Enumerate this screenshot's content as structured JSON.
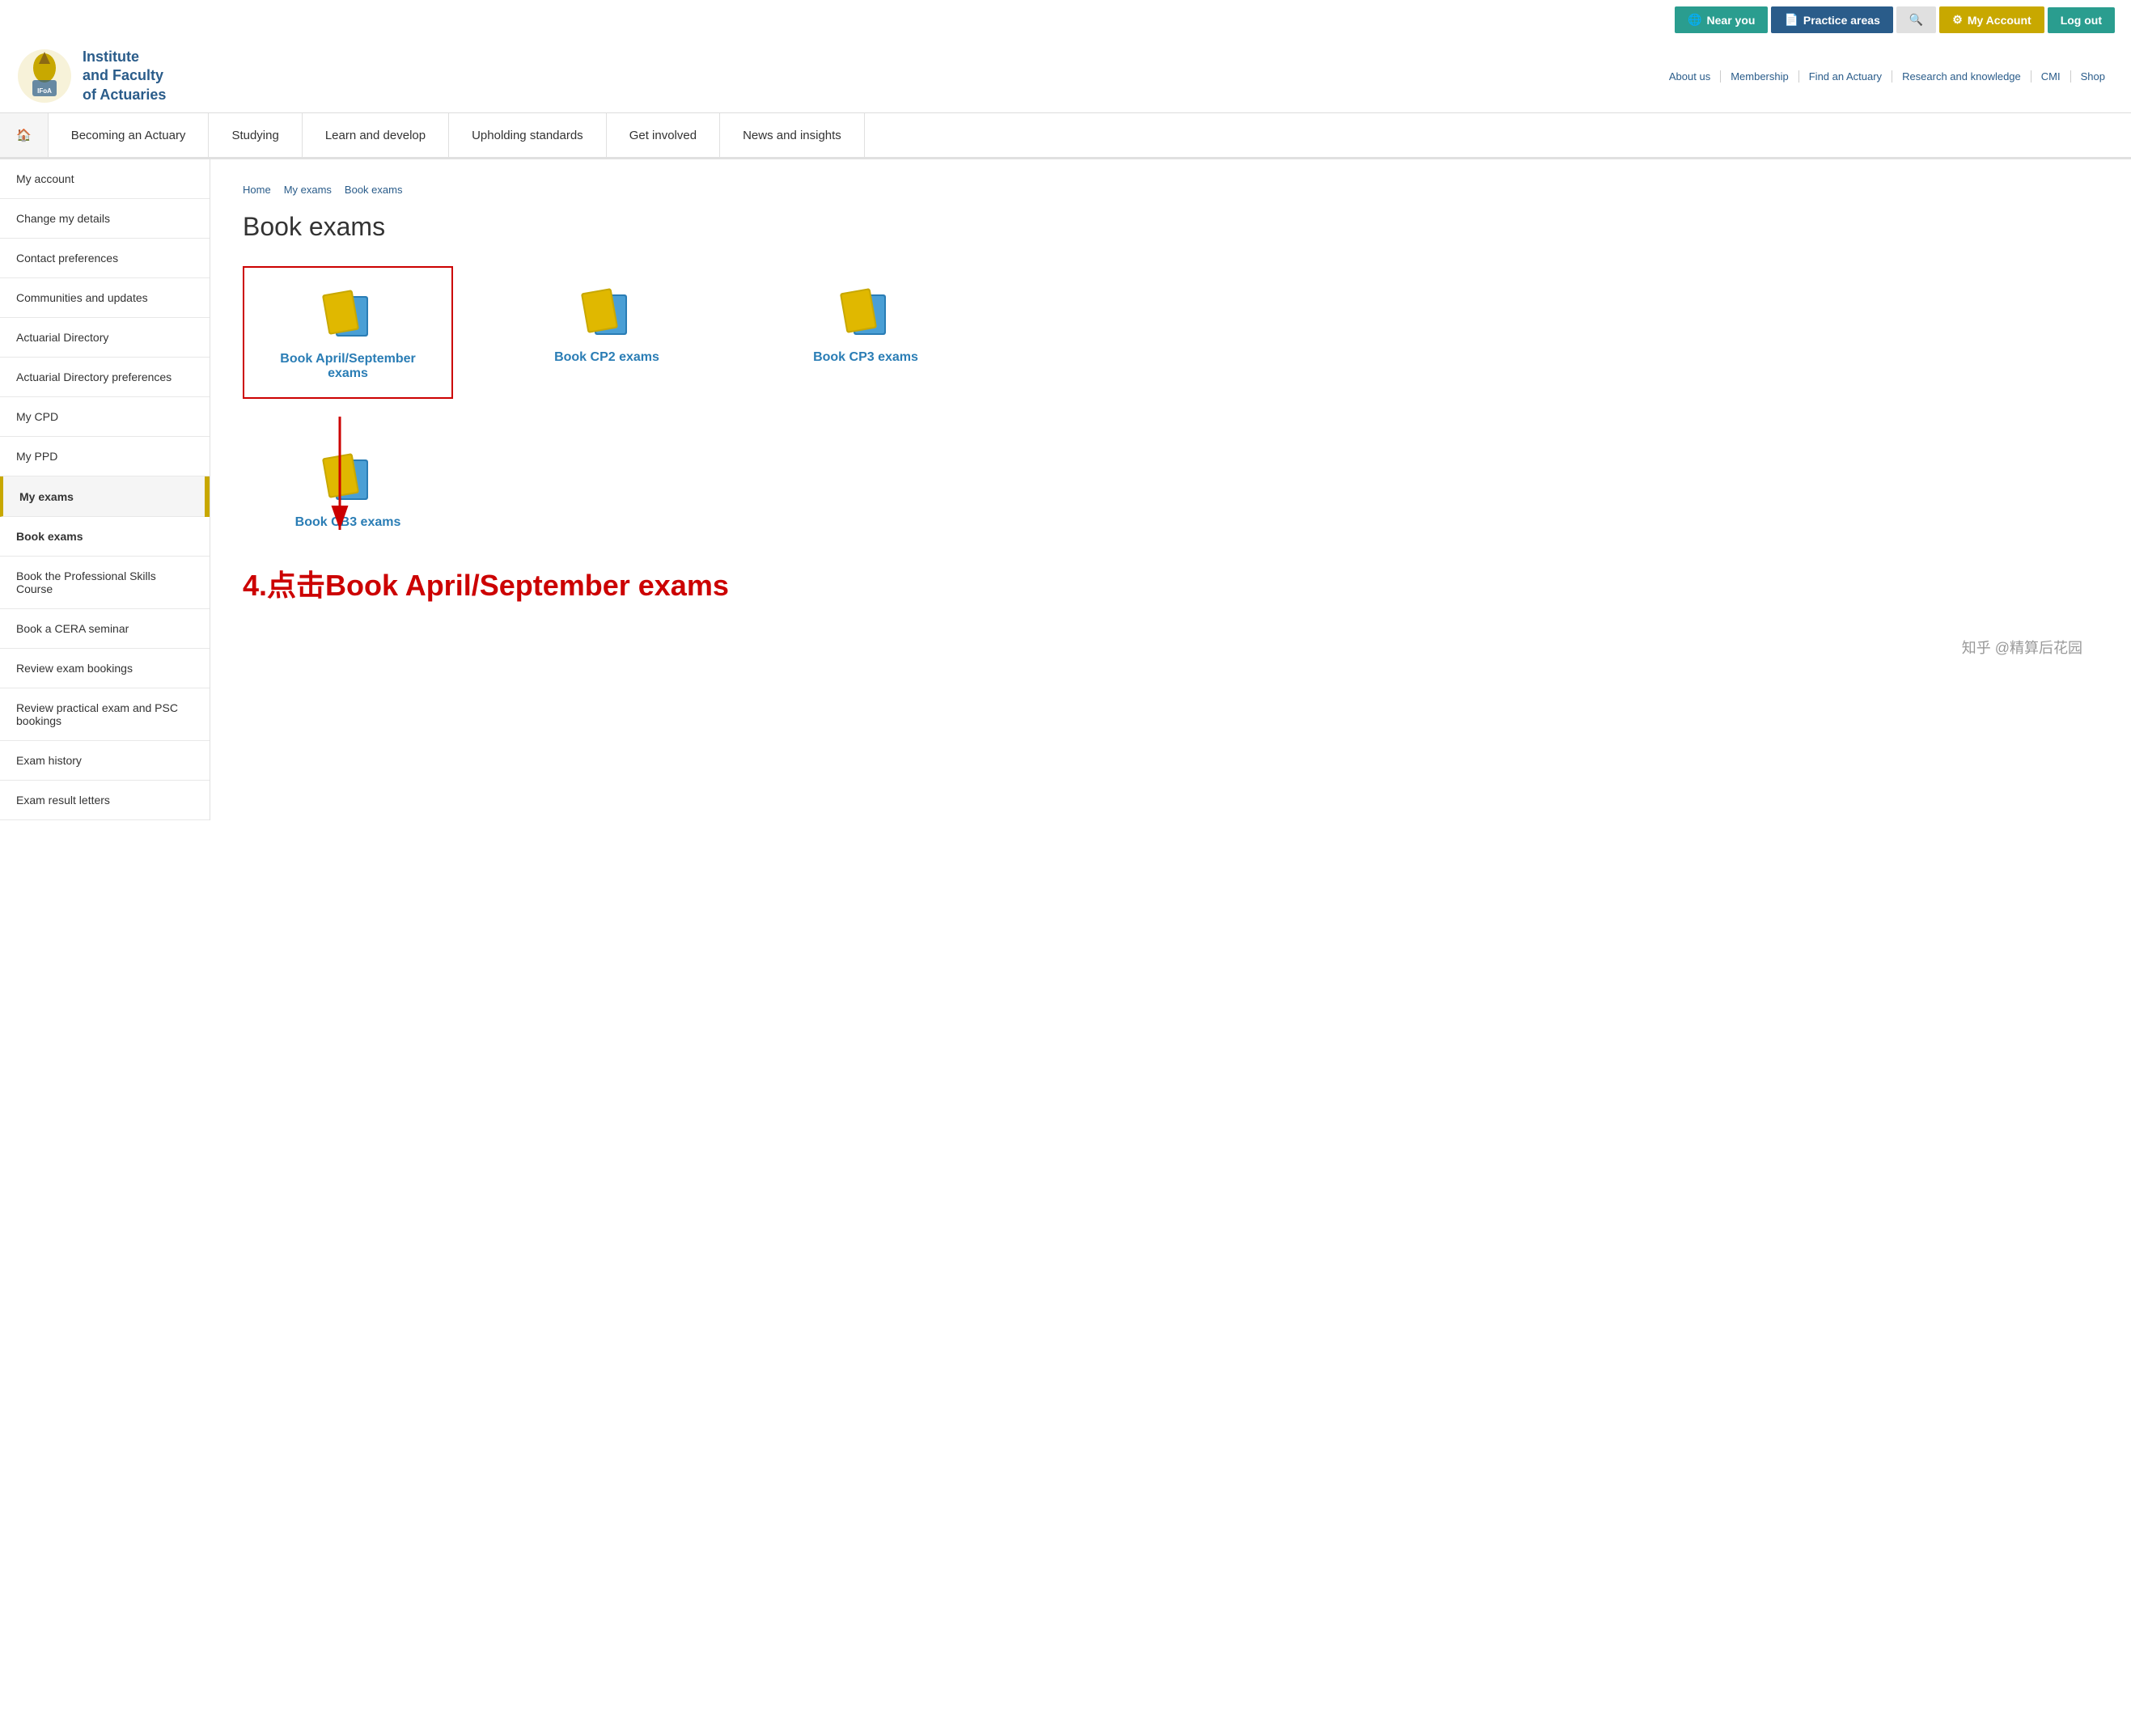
{
  "topBar": {
    "nearYou": "Near you",
    "practiceAreas": "Practice areas",
    "search": "🔍",
    "myAccount": "My Account",
    "logOut": "Log out"
  },
  "logo": {
    "line1": "Institute",
    "line2": "and Faculty",
    "line3": "of Actuaries"
  },
  "headerNav": [
    {
      "label": "About us"
    },
    {
      "label": "Membership"
    },
    {
      "label": "Find an Actuary"
    },
    {
      "label": "Research and knowledge"
    },
    {
      "label": "CMI"
    },
    {
      "label": "Shop"
    }
  ],
  "mainNav": [
    {
      "label": "🏠",
      "id": "home"
    },
    {
      "label": "Becoming an Actuary"
    },
    {
      "label": "Studying"
    },
    {
      "label": "Learn and develop"
    },
    {
      "label": "Upholding standards"
    },
    {
      "label": "Get involved"
    },
    {
      "label": "News and insights"
    }
  ],
  "sidebar": {
    "items": [
      {
        "label": "My account",
        "id": "my-account"
      },
      {
        "label": "Change my details",
        "id": "change-details"
      },
      {
        "label": "Contact preferences",
        "id": "contact-prefs"
      },
      {
        "label": "Communities and updates",
        "id": "communities"
      },
      {
        "label": "Actuarial Directory",
        "id": "actuarial-dir"
      },
      {
        "label": "Actuarial Directory preferences",
        "id": "actuarial-dir-prefs"
      },
      {
        "label": "My CPD",
        "id": "my-cpd"
      },
      {
        "label": "My PPD",
        "id": "my-ppd"
      },
      {
        "label": "My exams",
        "id": "my-exams",
        "active": true,
        "bold": true
      },
      {
        "label": "Book exams",
        "id": "book-exams",
        "bold": true
      },
      {
        "label": "Book the Professional Skills Course",
        "id": "book-psc"
      },
      {
        "label": "Book a CERA seminar",
        "id": "book-cera"
      },
      {
        "label": "Review exam bookings",
        "id": "review-bookings"
      },
      {
        "label": "Review practical exam and PSC bookings",
        "id": "review-practical"
      },
      {
        "label": "Exam history",
        "id": "exam-history"
      },
      {
        "label": "Exam result letters",
        "id": "exam-results"
      }
    ]
  },
  "breadcrumb": {
    "home": "Home",
    "myExams": "My exams",
    "bookExams": "Book exams"
  },
  "pageTitle": "Book exams",
  "examCards": [
    {
      "label": "Book April/September exams",
      "id": "april-sept",
      "highlighted": true
    },
    {
      "label": "Book CP2 exams",
      "id": "cp2"
    },
    {
      "label": "Book CP3 exams",
      "id": "cp3"
    },
    {
      "label": "Book CB3 exams",
      "id": "cb3"
    }
  ],
  "annotation": {
    "text": "4.点击Book April/September exams"
  },
  "watermark": "知乎 @精算后花园",
  "colors": {
    "gold": "#c8a800",
    "blue": "#2a5c8a",
    "teal": "#2a9d8f",
    "linkBlue": "#2a7db5",
    "red": "#cc0000"
  }
}
